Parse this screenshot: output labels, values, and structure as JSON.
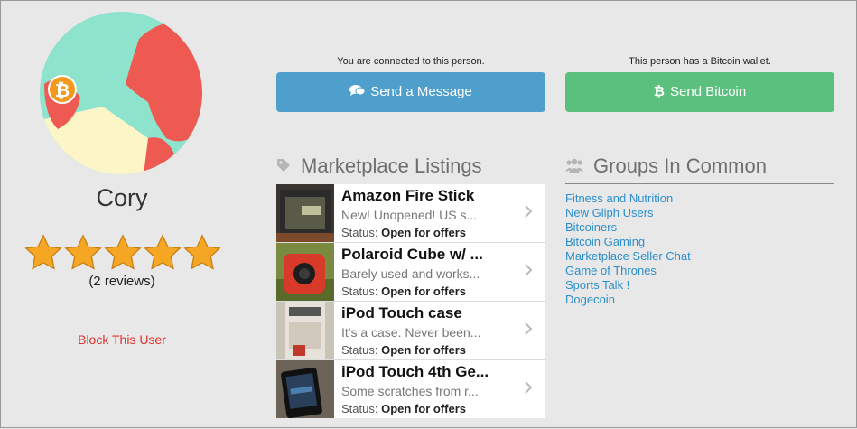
{
  "profile": {
    "name": "Cory",
    "avatar_badge": "₿",
    "rating_stars": 5,
    "reviews": "(2 reviews)",
    "block_label": "Block This User"
  },
  "actions": {
    "message_notice": "You are connected to this person.",
    "message_label": "Send a Message",
    "message_icon": "chat-bubbles-icon",
    "bitcoin_notice": "This person has a Bitcoin wallet.",
    "bitcoin_label": "Send Bitcoin",
    "bitcoin_icon": "bitcoin-icon"
  },
  "marketplace": {
    "title": "Marketplace Listings",
    "icon": "tag-icon",
    "status_label": "Status:",
    "listings": [
      {
        "title": "Amazon Fire Stick",
        "desc": "New! Unopened! US s...",
        "status": "Open for offers"
      },
      {
        "title": "Polaroid Cube w/ ...",
        "desc": "Barely used and works...",
        "status": "Open for offers"
      },
      {
        "title": "iPod Touch case",
        "desc": "It's a case. Never been...",
        "status": "Open for offers"
      },
      {
        "title": "iPod Touch 4th Ge...",
        "desc": "Some scratches from r...",
        "status": "Open for offers"
      }
    ]
  },
  "groups": {
    "title": "Groups In Common",
    "icon": "users-icon",
    "items": [
      "Fitness and Nutrition",
      "New Gliph Users",
      "Bitcoiners",
      "Bitcoin Gaming",
      "Marketplace Seller Chat",
      "Game of Thrones",
      "Sports Talk !",
      "Dogecoin"
    ]
  },
  "colors": {
    "message_button": "#4f9fcd",
    "bitcoin_button": "#5bc07d",
    "link": "#2b8fcc",
    "block_link": "#e0322b",
    "star": "#f5a623"
  }
}
